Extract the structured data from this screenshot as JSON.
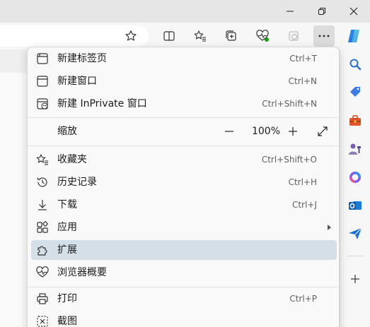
{
  "window": {
    "minimize_icon": "minimize-icon",
    "restore_icon": "restore-icon",
    "close_icon": "close-icon"
  },
  "toolbar": {
    "favorite_star_icon": "star-outline-icon",
    "split_screen_icon": "split-screen-icon",
    "favorites_icon": "favorites-icon",
    "collections_icon": "collections-icon",
    "browser_essentials_icon": "heart-pulse-icon",
    "extension_icon": "extension-disabled-icon",
    "more_icon": "more-dots-icon",
    "copilot_icon": "copilot-icon"
  },
  "menu": {
    "items": [
      {
        "label": "新建标签页",
        "shortcut": "Ctrl+T",
        "icon": "new-tab-icon"
      },
      {
        "label": "新建窗口",
        "shortcut": "Ctrl+N",
        "icon": "new-window-icon"
      },
      {
        "label": "新建 InPrivate 窗口",
        "shortcut": "Ctrl+Shift+N",
        "icon": "inprivate-icon"
      }
    ],
    "zoom": {
      "label": "缩放",
      "decrease": "—",
      "value": "100%",
      "increase": "+",
      "fullscreen_icon": "fullscreen-icon"
    },
    "items2": [
      {
        "label": "收藏夹",
        "shortcut": "Ctrl+Shift+O",
        "icon": "favorites-icon"
      },
      {
        "label": "历史记录",
        "shortcut": "Ctrl+H",
        "icon": "history-icon"
      },
      {
        "label": "下载",
        "shortcut": "Ctrl+J",
        "icon": "download-icon"
      },
      {
        "label": "应用",
        "shortcut": "",
        "icon": "apps-icon",
        "submenu": true
      },
      {
        "label": "扩展",
        "shortcut": "",
        "icon": "extensions-icon",
        "highlighted": true
      },
      {
        "label": "浏览器概要",
        "shortcut": "",
        "icon": "browser-essentials-icon"
      }
    ],
    "items3": [
      {
        "label": "打印",
        "shortcut": "Ctrl+P",
        "icon": "print-icon"
      },
      {
        "label": "截图",
        "shortcut": "",
        "icon": "screenshot-icon"
      }
    ]
  },
  "sidebar": {
    "icons": [
      "search-icon",
      "shopping-tag-icon",
      "tools-icon",
      "games-icon",
      "microsoft365-icon",
      "outlook-icon",
      "drop-icon",
      "add-icon"
    ]
  },
  "colors": {
    "highlight": "#d5dfe8",
    "accent_blue": "#1a73e8"
  }
}
